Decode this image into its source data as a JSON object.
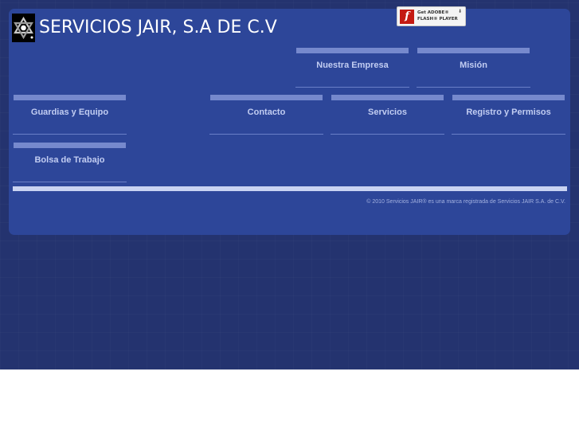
{
  "header": {
    "title": "SERVICIOS JAIR, S.A DE C.V",
    "logo_icon": "star-of-david-logo-icon"
  },
  "flash_badge": {
    "line1": "Get ADOBE®",
    "line2": "FLASH® PLAYER",
    "icon": "flash-player-icon"
  },
  "nav": {
    "items": [
      {
        "label": "Nuestra Empresa"
      },
      {
        "label": "Misión"
      },
      {
        "label": "Guardias y Equipo"
      },
      {
        "label": "Contacto"
      },
      {
        "label": "Servicios"
      },
      {
        "label": "Registro y Permisos"
      },
      {
        "label": "Bolsa de Trabajo"
      }
    ]
  },
  "footer": {
    "copyright": "© 2010 Servicios JAIR® es una marca registrada de Servicios JAIR S.A. de C.V."
  },
  "colors": {
    "background": "#24336f",
    "panel": "#2d4699",
    "nav_bar": "#7689cd",
    "nav_text": "#c2cdf2",
    "divider": "#c9d3f2"
  }
}
